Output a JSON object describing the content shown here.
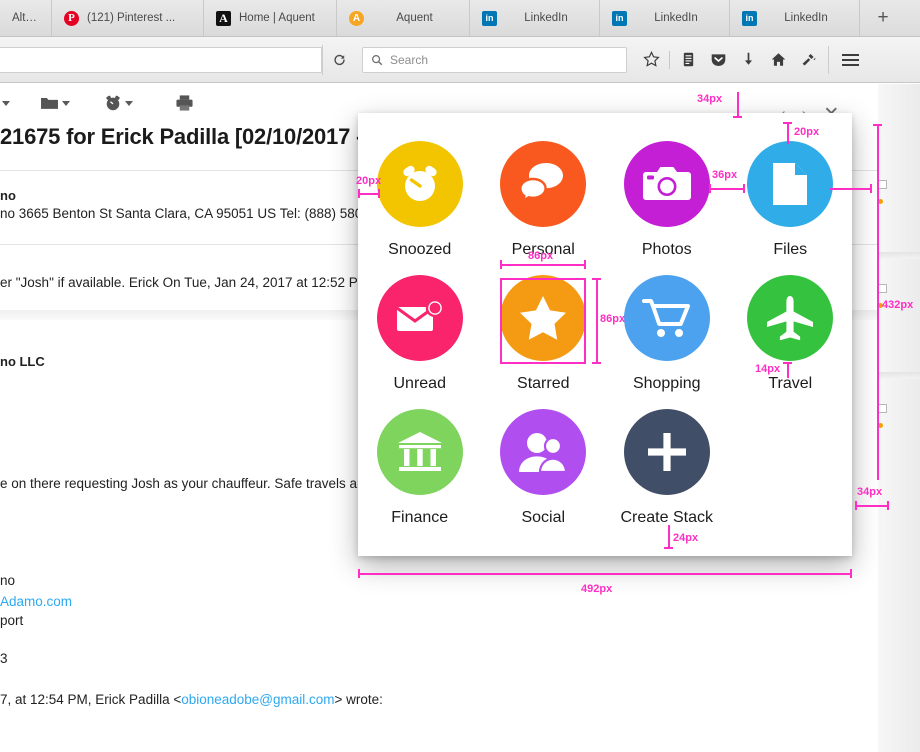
{
  "browser": {
    "tabs": [
      {
        "label": "Alto...",
        "icon": "generic-favicon",
        "favclass": ""
      },
      {
        "label": "(121) Pinterest ...",
        "icon": "pinterest-icon",
        "favclass": "fav-pinterest",
        "glyph": "P"
      },
      {
        "label": "Home | Aquent",
        "icon": "aquent-icon",
        "favclass": "fav-aquent-a",
        "glyph": "A"
      },
      {
        "label": "Aquent",
        "icon": "aquent-circle-icon",
        "favclass": "fav-aquent-o",
        "glyph": "A"
      },
      {
        "label": "LinkedIn",
        "icon": "linkedin-icon",
        "favclass": "fav-li",
        "glyph": "in"
      },
      {
        "label": "LinkedIn",
        "icon": "linkedin-icon",
        "favclass": "fav-li",
        "glyph": "in"
      },
      {
        "label": "LinkedIn",
        "icon": "linkedin-icon",
        "favclass": "fav-li",
        "glyph": "in"
      }
    ],
    "new_tab_label": "+",
    "reload_icon": "reload-icon",
    "url_value": "",
    "search": {
      "placeholder": "Search",
      "value": "",
      "icon": "search-icon"
    },
    "toolbar_icons": [
      {
        "name": "bookmark-star-icon",
        "glyph": "☆"
      },
      {
        "name": "reading-list-icon",
        "glyph": "὜9"
      },
      {
        "name": "pocket-icon",
        "glyph": "▼"
      },
      {
        "name": "downloads-icon",
        "glyph": "↓"
      },
      {
        "name": "home-icon",
        "glyph": "⌂"
      },
      {
        "name": "extension-icon",
        "glyph": "✂"
      }
    ],
    "menu_icon": "hamburger-menu-icon"
  },
  "mail": {
    "toolbar": [
      {
        "name": "reply-dropdown",
        "icon": "caret-down-icon"
      },
      {
        "name": "move-to-folder",
        "icon": "folder-icon"
      },
      {
        "name": "snooze-dropdown",
        "icon": "alarm-clock-icon"
      },
      {
        "name": "print-button",
        "icon": "printer-icon"
      }
    ],
    "subject": "21675 for Erick Padilla [02/10/2017 - 1",
    "sender_line1": "no",
    "sender_line2": "no 3665 Benton St Santa Clara, CA 95051 US Tel: (888) 580-8",
    "quote_line": "er \"Josh\" if available. Erick On Tue, Jan 24, 2017 at 12:52 PM, (",
    "company": "no LLC",
    "body_line": "e on there requesting Josh as your chauffeur. Safe travels an",
    "sig_name": "no",
    "sig_link": "Adamo.com",
    "sig_role": "port",
    "sig_phone": "3",
    "reply_prefix": "7, at 12:54 PM, Erick Padilla <",
    "reply_email": "obioneadobe@gmail.com",
    "reply_suffix": "> wrote:"
  },
  "panel": {
    "controls": [
      {
        "name": "prev-button",
        "glyph": "‹"
      },
      {
        "name": "next-button",
        "glyph": "›"
      },
      {
        "name": "close-button",
        "glyph": "✕"
      }
    ],
    "items": [
      {
        "label": "Snoozed",
        "icon": "alarm-clock-icon",
        "color": "#f2c500"
      },
      {
        "label": "Personal",
        "icon": "chat-bubbles-icon",
        "color": "#f9591f"
      },
      {
        "label": "Photos",
        "icon": "camera-icon",
        "color": "#c51fd6"
      },
      {
        "label": "Files",
        "icon": "document-icon",
        "color": "#30ace8"
      },
      {
        "label": "Unread",
        "icon": "envelope-icon",
        "color": "#f9246b"
      },
      {
        "label": "Starred",
        "icon": "star-icon",
        "color": "#f59b13"
      },
      {
        "label": "Shopping",
        "icon": "shopping-cart-icon",
        "color": "#4da2f0"
      },
      {
        "label": "Travel",
        "icon": "airplane-icon",
        "color": "#35c23f"
      },
      {
        "label": "Finance",
        "icon": "bank-icon",
        "color": "#7ed45c"
      },
      {
        "label": "Social",
        "icon": "people-icon",
        "color": "#b14ef0"
      },
      {
        "label": "Create Stack",
        "icon": "plus-icon",
        "color": "#414e67"
      }
    ]
  },
  "annotations": {
    "accent_color": "#ff2ec4",
    "measurements": [
      {
        "name": "panel-left-padding",
        "value": "20px"
      },
      {
        "name": "panel-top-offset",
        "value": "34px"
      },
      {
        "name": "icon-top-padding",
        "value": "20px"
      },
      {
        "name": "icon-horizontal-gap",
        "value": "36px"
      },
      {
        "name": "icon-width",
        "value": "86px"
      },
      {
        "name": "icon-height",
        "value": "86px"
      },
      {
        "name": "label-gap",
        "value": "14px"
      },
      {
        "name": "panel-height",
        "value": "432px"
      },
      {
        "name": "panel-right-offset",
        "value": "34px"
      },
      {
        "name": "panel-bottom-padding",
        "value": "24px"
      },
      {
        "name": "panel-width",
        "value": "492px"
      }
    ]
  }
}
